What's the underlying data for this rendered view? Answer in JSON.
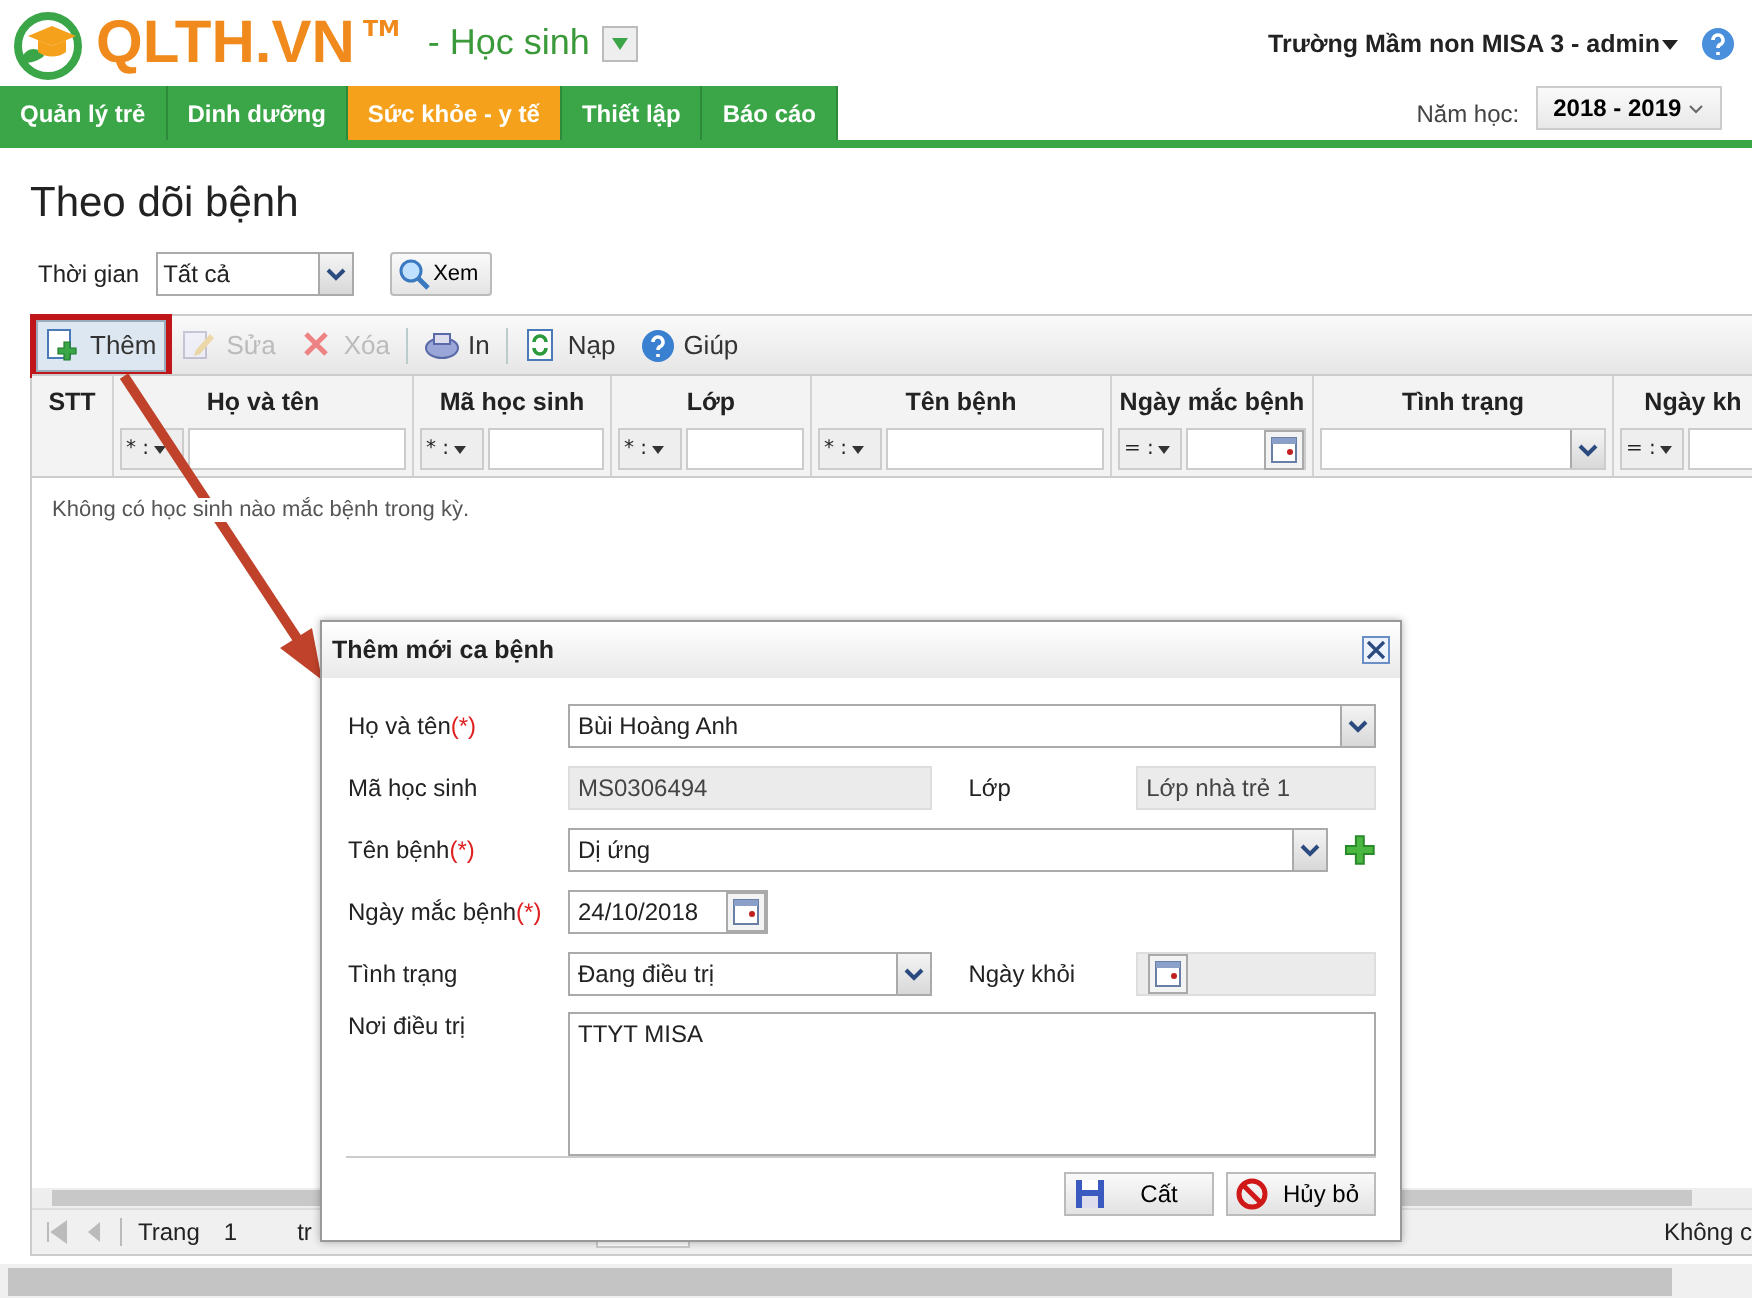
{
  "header": {
    "logo": "QLTH.VN",
    "trademark": "TM",
    "module": "- Học sinh",
    "user": "Trường Mầm non MISA 3 - admin"
  },
  "nav": {
    "tabs": [
      {
        "label": "Quản lý trẻ",
        "selected": false
      },
      {
        "label": "Dinh dưỡng",
        "selected": false
      },
      {
        "label": "Sức khỏe - y tế",
        "selected": true
      },
      {
        "label": "Thiết lập",
        "selected": false
      },
      {
        "label": "Báo cáo",
        "selected": false
      }
    ],
    "year_label": "Năm học:",
    "year": "2018 - 2019"
  },
  "page": {
    "title": "Theo dõi bệnh",
    "filter_label": "Thời gian",
    "filter_value": "Tất cả",
    "view_button": "Xem"
  },
  "toolbar": [
    {
      "label": "Thêm",
      "kind": "add",
      "disabled": false,
      "highlighted": true
    },
    {
      "label": "Sửa",
      "kind": "edit",
      "disabled": true,
      "highlighted": false
    },
    {
      "label": "Xóa",
      "kind": "delete",
      "disabled": true,
      "highlighted": false
    },
    {
      "label": "In",
      "kind": "print",
      "disabled": false,
      "highlighted": false
    },
    {
      "label": "Nạp",
      "kind": "reload",
      "disabled": false,
      "highlighted": false
    },
    {
      "label": "Giúp",
      "kind": "help",
      "disabled": false,
      "highlighted": false
    }
  ],
  "table": {
    "columns": [
      {
        "label": "STT",
        "kind": "plain"
      },
      {
        "label": "Họ và tên",
        "kind": "text",
        "operator": "* :"
      },
      {
        "label": "Mã học sinh",
        "kind": "text",
        "operator": "* :"
      },
      {
        "label": "Lớp",
        "kind": "text",
        "operator": "* :"
      },
      {
        "label": "Tên bệnh",
        "kind": "text",
        "operator": "* :"
      },
      {
        "label": "Ngày mắc bệnh",
        "kind": "date",
        "operator": "= :"
      },
      {
        "label": "Tình trạng",
        "kind": "select"
      },
      {
        "label": "Ngày kh",
        "kind": "text",
        "operator": "= :"
      }
    ],
    "empty_message": "Không có học sinh nào mắc bệnh trong kỳ."
  },
  "pager": {
    "page_label": "Trang",
    "page": "1",
    "of_label": "tr",
    "summary": "Không c"
  },
  "dialog": {
    "title": "Thêm mới ca bệnh",
    "required_mark": "(*)",
    "fields": [
      {
        "label": "Họ và tên",
        "required": true,
        "kind": "select",
        "value": "Bùi Hoàng Anh"
      },
      {
        "label": "Mã học sinh",
        "required": false,
        "kind": "readonly",
        "value": "MS0306494",
        "side_label": "Lớp",
        "side_value": "Lớp nhà trẻ 1"
      },
      {
        "label": "Tên bệnh",
        "required": true,
        "kind": "select-add",
        "value": "Dị ứng"
      },
      {
        "label": "Ngày mắc bệnh",
        "required": true,
        "kind": "date",
        "value": "24/10/2018"
      },
      {
        "label": "Tình trạng",
        "required": false,
        "kind": "select-date",
        "value": "Đang điều trị",
        "side_label": "Ngày khỏi"
      },
      {
        "label": "Nơi điều trị",
        "required": false,
        "kind": "textarea",
        "value": "TTYT MISA"
      }
    ],
    "buttons": [
      {
        "label": "Cất",
        "kind": "save"
      },
      {
        "label": "Hủy bỏ",
        "kind": "cancel"
      }
    ]
  }
}
